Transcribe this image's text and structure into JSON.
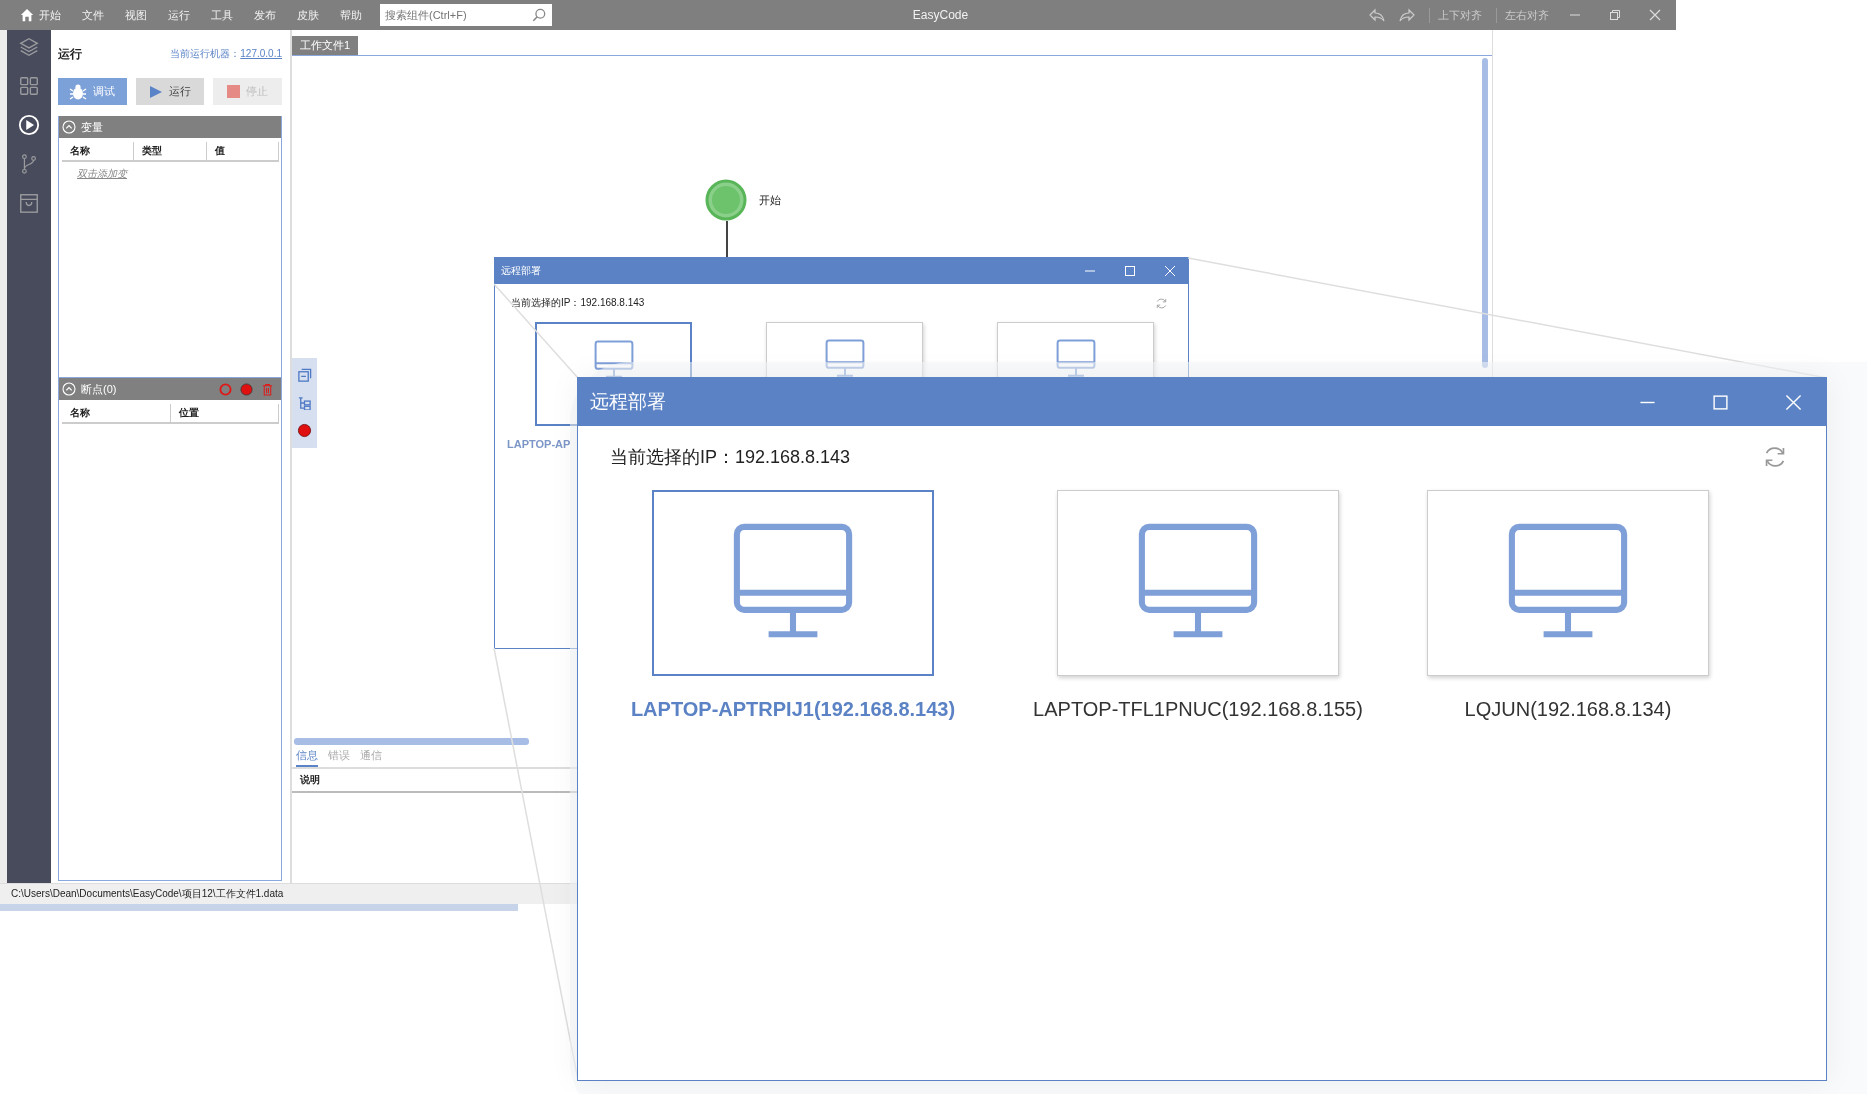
{
  "window": {
    "title": "EasyCode"
  },
  "menu": [
    {
      "label": "开始",
      "kind": "home"
    },
    {
      "label": "文件",
      "kind": "plain"
    },
    {
      "label": "视图",
      "kind": "plain"
    },
    {
      "label": "运行",
      "kind": "plain"
    },
    {
      "label": "工具",
      "kind": "plain"
    },
    {
      "label": "发布",
      "kind": "plain"
    },
    {
      "label": "皮肤",
      "kind": "plain"
    },
    {
      "label": "帮助",
      "kind": "plain"
    }
  ],
  "search": {
    "placeholder": "搜索组件(Ctrl+F)"
  },
  "title_tools": [
    {
      "kind": "undo"
    },
    {
      "kind": "redo"
    },
    {
      "kind": "text",
      "label": "上下对齐"
    },
    {
      "kind": "text",
      "label": "左右对齐"
    }
  ],
  "activity_bar": [
    {
      "kind": "layers",
      "selected": false
    },
    {
      "kind": "grid",
      "selected": false
    },
    {
      "kind": "play",
      "selected": true
    },
    {
      "kind": "branch",
      "selected": false
    },
    {
      "kind": "bag",
      "selected": false
    }
  ],
  "run_panel": {
    "title": "运行",
    "machine_label": "当前运行机器：",
    "machine_link": "127.0.0.1",
    "buttons": [
      {
        "kind": "debug",
        "label": "调试",
        "active": true,
        "disabled": false
      },
      {
        "kind": "run",
        "label": "运行",
        "active": false,
        "disabled": false
      },
      {
        "kind": "stop",
        "label": "停止",
        "active": false,
        "disabled": true
      }
    ]
  },
  "variables": {
    "title": "变量",
    "columns": [
      "名称",
      "类型",
      "值"
    ],
    "hint": "双击添加变"
  },
  "breakpoints": {
    "title": "断点(0)",
    "columns": [
      "名称",
      "位置"
    ]
  },
  "editor_tabs": [
    {
      "label": "工作文件1",
      "selected": true
    }
  ],
  "canvas": {
    "start_node": {
      "label": "开始"
    },
    "tools": [
      {
        "kind": "window"
      },
      {
        "kind": "tree"
      },
      {
        "kind": "record"
      }
    ]
  },
  "output": {
    "tabs": [
      {
        "label": "信息",
        "selected": true
      },
      {
        "label": "错误",
        "selected": false
      },
      {
        "label": "通信",
        "selected": false
      }
    ],
    "columns": [
      "说明"
    ]
  },
  "status_bar": {
    "path": "C:\\Users\\Dean\\Documents\\EasyCode\\项目12\\工作文件1.data"
  },
  "dialog": {
    "title": "远程部署",
    "ip_text": "当前选择的IP：192.168.8.143",
    "devices": [
      {
        "label": "LAPTOP-AP",
        "selected": true
      },
      {
        "selected": false
      },
      {
        "selected": false
      }
    ]
  },
  "dialog_zoomed": {
    "title": "远程部署",
    "ip_text": "当前选择的IP：192.168.8.143",
    "devices": [
      {
        "label": "LAPTOP-APTRPIJ1(192.168.8.143)",
        "selected": true
      },
      {
        "label": "LAPTOP-TFL1PNUC(192.168.8.155)",
        "selected": false
      },
      {
        "label": "LQJUN(192.168.8.134)",
        "selected": false
      }
    ]
  }
}
